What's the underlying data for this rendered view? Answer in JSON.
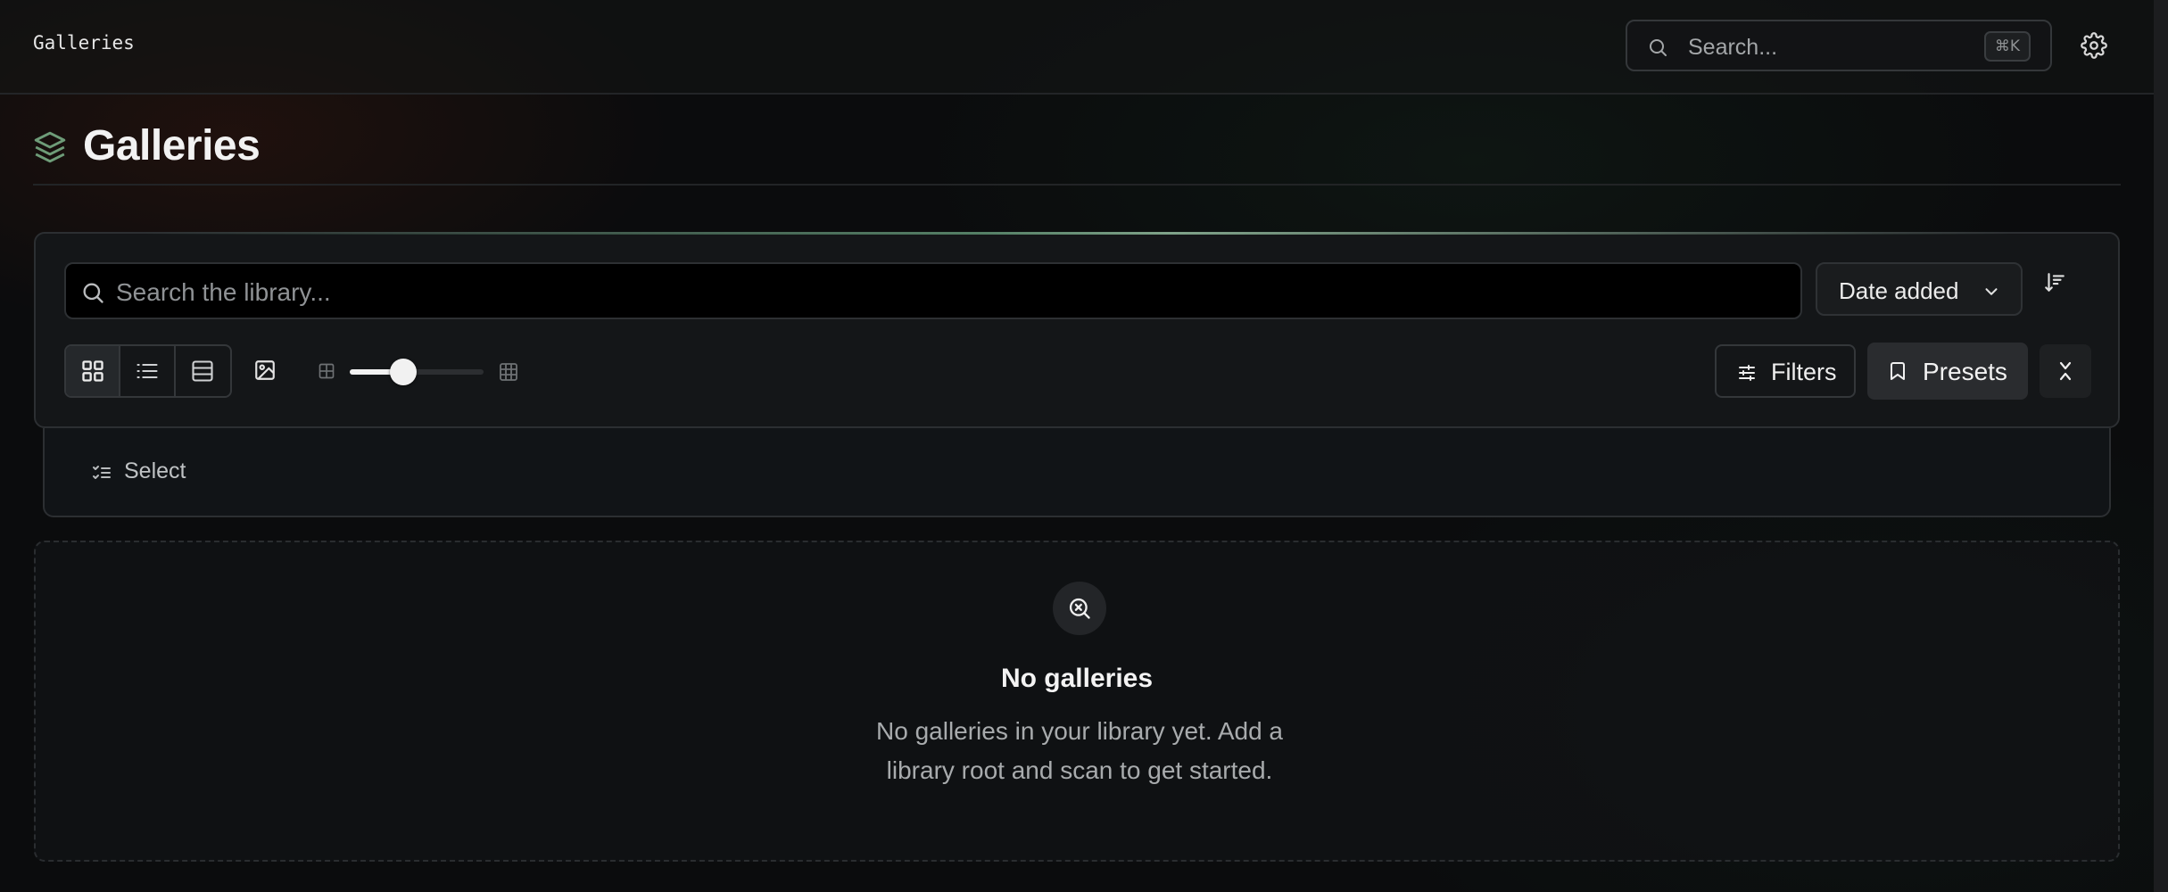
{
  "topbar": {
    "breadcrumb": "Galleries",
    "search_placeholder": "Search...",
    "search_shortcut": "⌘K",
    "icons": {
      "search": "search-icon",
      "settings": "gear-icon"
    }
  },
  "page": {
    "title": "Galleries",
    "title_icon": "layers-icon",
    "accent_color": "#6e9c78"
  },
  "toolbar": {
    "search_placeholder": "Search the library...",
    "sort_label": "Date added",
    "view_modes": [
      "grid",
      "list",
      "table"
    ],
    "active_view": "grid",
    "card_size": 0.4,
    "filters_label": "Filters",
    "presets_label": "Presets"
  },
  "select_bar": {
    "label": "Select"
  },
  "empty_state": {
    "title": "No galleries",
    "message": "No galleries in your library yet. Add a library root and scan to get started."
  }
}
